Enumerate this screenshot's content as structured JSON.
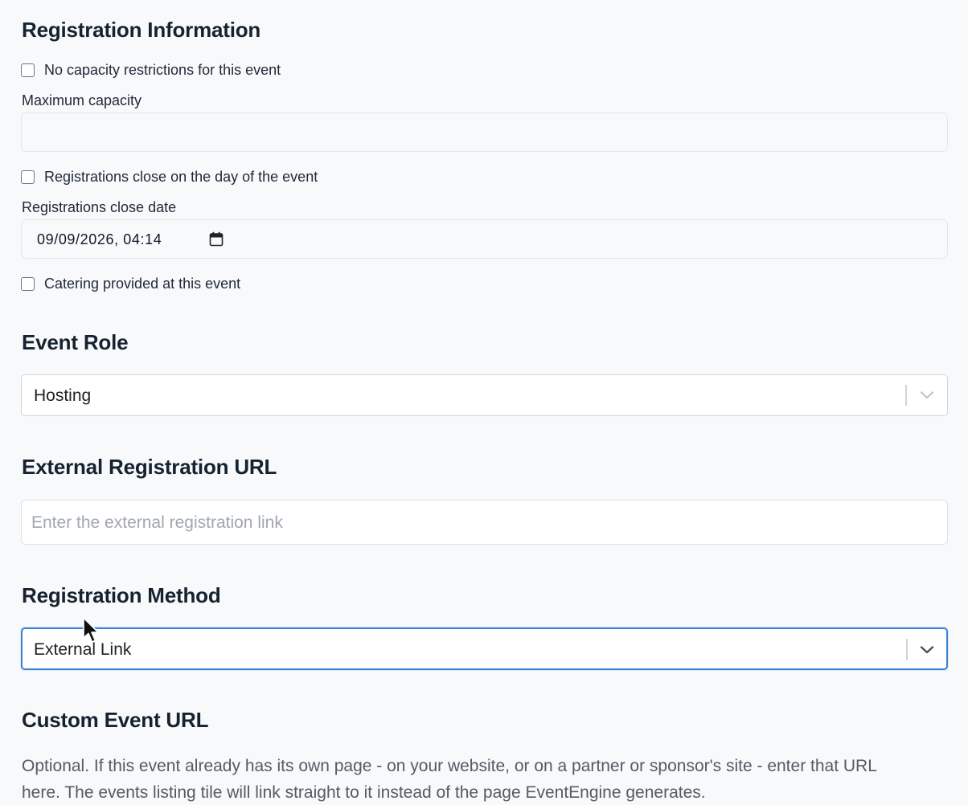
{
  "registration": {
    "heading": "Registration Information",
    "no_capacity_label": "No capacity restrictions for this event",
    "max_capacity_label": "Maximum capacity",
    "max_capacity_value": "",
    "close_day_label": "Registrations close on the day of the event",
    "close_date_label": "Registrations close date",
    "close_date_value": "09/09/2026, 04:14",
    "catering_label": "Catering provided at this event"
  },
  "event_role": {
    "heading": "Event Role",
    "selected": "Hosting"
  },
  "external_url": {
    "heading": "External Registration URL",
    "placeholder": "Enter the external registration link"
  },
  "registration_method": {
    "heading": "Registration Method",
    "selected": "External Link"
  },
  "custom_url": {
    "heading": "Custom Event URL",
    "helper_line1": "Optional. If this event already has its own page - on your website, or on a partner or sponsor's site - enter that URL",
    "helper_line2": "here. The events listing tile will link straight to it instead of the page EventEngine generates."
  },
  "icons": [
    "calendar-icon",
    "chevron-down-icon",
    "mouse-cursor-icon"
  ],
  "colors": {
    "focus": "#3b82d6",
    "background": "#f7f9fb"
  }
}
